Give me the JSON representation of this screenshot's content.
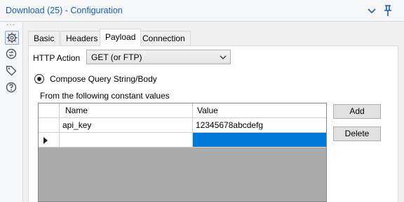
{
  "window": {
    "title": "Download (25) - Configuration"
  },
  "tabs": [
    {
      "label": "Basic",
      "selected": false
    },
    {
      "label": "Headers",
      "selected": false
    },
    {
      "label": "Payload",
      "selected": true
    },
    {
      "label": "Connection",
      "selected": false
    }
  ],
  "payload": {
    "http_action_label": "HTTP Action",
    "http_action_value": "GET (or FTP)",
    "radio_label": "Compose Query String/Body",
    "section_label": "From the following constant values"
  },
  "grid": {
    "columns": [
      "Name",
      "Value"
    ],
    "rows": [
      {
        "name": "api_key",
        "value": "12345678abcdefg"
      }
    ]
  },
  "buttons": {
    "add": "Add",
    "delete": "Delete"
  },
  "icons": {
    "leftbar": [
      "gear-icon",
      "connection-icon",
      "tag-icon",
      "help-icon"
    ],
    "titlebar": [
      "chevron-down-icon",
      "pin-icon"
    ]
  },
  "colors": {
    "accent": "#1b5fa8",
    "selection": "#0078d7"
  }
}
